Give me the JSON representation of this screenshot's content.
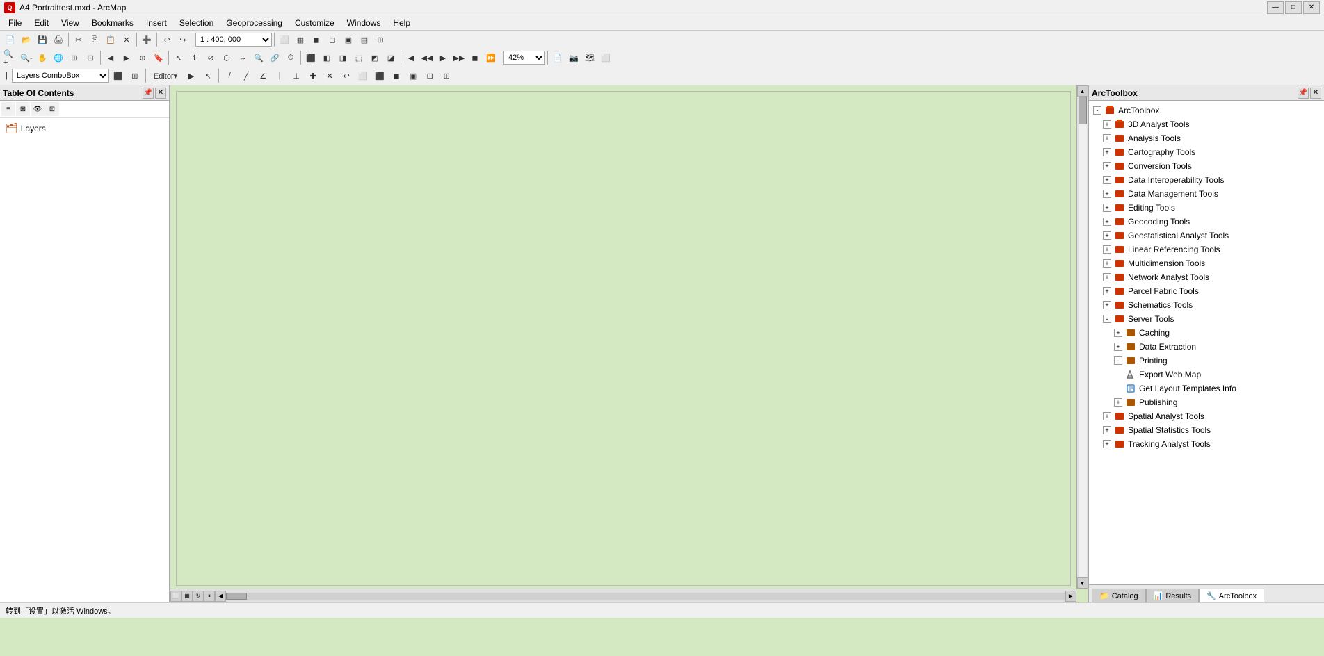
{
  "titleBar": {
    "title": "A4 Portraittest.mxd - ArcMap",
    "appIcon": "Q",
    "minBtn": "—",
    "maxBtn": "□",
    "closeBtn": "✕"
  },
  "menuBar": {
    "items": [
      "File",
      "Edit",
      "View",
      "Bookmarks",
      "Insert",
      "Selection",
      "Geoprocessing",
      "Customize",
      "Windows",
      "Help"
    ]
  },
  "toolbar": {
    "scale": "1 : 400, 000",
    "zoomPercent": "42%"
  },
  "editorToolbar": {
    "layersComboBox": "Layers ComboBox",
    "editorLabel": "Editor▾"
  },
  "toc": {
    "title": "Table Of Contents",
    "layers": [
      {
        "name": "Layers",
        "type": "group"
      }
    ]
  },
  "arctoolbox": {
    "title": "ArcToolbox",
    "root": "ArcToolbox",
    "items": [
      {
        "id": "3d-analyst",
        "label": "3D Analyst Tools",
        "level": 1,
        "expanded": false,
        "hasChildren": true
      },
      {
        "id": "analysis",
        "label": "Analysis Tools",
        "level": 1,
        "expanded": false,
        "hasChildren": true
      },
      {
        "id": "cartography",
        "label": "Cartography Tools",
        "level": 1,
        "expanded": false,
        "hasChildren": true
      },
      {
        "id": "conversion",
        "label": "Conversion Tools",
        "level": 1,
        "expanded": false,
        "hasChildren": true
      },
      {
        "id": "data-interop",
        "label": "Data Interoperability Tools",
        "level": 1,
        "expanded": false,
        "hasChildren": true
      },
      {
        "id": "data-mgmt",
        "label": "Data Management Tools",
        "level": 1,
        "expanded": false,
        "hasChildren": true
      },
      {
        "id": "editing",
        "label": "Editing Tools",
        "level": 1,
        "expanded": false,
        "hasChildren": true
      },
      {
        "id": "geocoding",
        "label": "Geocoding Tools",
        "level": 1,
        "expanded": false,
        "hasChildren": true
      },
      {
        "id": "geostatistical",
        "label": "Geostatistical Analyst Tools",
        "level": 1,
        "expanded": false,
        "hasChildren": true
      },
      {
        "id": "linear-ref",
        "label": "Linear Referencing Tools",
        "level": 1,
        "expanded": false,
        "hasChildren": true
      },
      {
        "id": "multidimension",
        "label": "Multidimension Tools",
        "level": 1,
        "expanded": false,
        "hasChildren": true
      },
      {
        "id": "network-analyst",
        "label": "Network Analyst Tools",
        "level": 1,
        "expanded": false,
        "hasChildren": true
      },
      {
        "id": "parcel-fabric",
        "label": "Parcel Fabric Tools",
        "level": 1,
        "expanded": false,
        "hasChildren": true
      },
      {
        "id": "schematics",
        "label": "Schematics Tools",
        "level": 1,
        "expanded": false,
        "hasChildren": true
      },
      {
        "id": "server",
        "label": "Server Tools",
        "level": 1,
        "expanded": true,
        "hasChildren": true
      },
      {
        "id": "caching",
        "label": "Caching",
        "level": 2,
        "expanded": false,
        "hasChildren": true
      },
      {
        "id": "data-extraction",
        "label": "Data Extraction",
        "level": 2,
        "expanded": false,
        "hasChildren": true
      },
      {
        "id": "printing",
        "label": "Printing",
        "level": 2,
        "expanded": true,
        "hasChildren": true
      },
      {
        "id": "export-web-map",
        "label": "Export Web Map",
        "level": 3,
        "expanded": false,
        "hasChildren": false
      },
      {
        "id": "get-layout-templates",
        "label": "Get Layout Templates Info",
        "level": 3,
        "expanded": false,
        "hasChildren": false
      },
      {
        "id": "publishing",
        "label": "Publishing",
        "level": 2,
        "expanded": false,
        "hasChildren": true
      },
      {
        "id": "spatial-analyst",
        "label": "Spatial Analyst Tools",
        "level": 1,
        "expanded": false,
        "hasChildren": true
      },
      {
        "id": "spatial-statistics",
        "label": "Spatial Statistics Tools",
        "level": 1,
        "expanded": false,
        "hasChildren": true
      },
      {
        "id": "tracking-analyst",
        "label": "Tracking Analyst Tools",
        "level": 1,
        "expanded": false,
        "hasChildren": true
      }
    ]
  },
  "bottomTabs": {
    "items": [
      {
        "id": "catalog",
        "label": "Catalog"
      },
      {
        "id": "results",
        "label": "Results",
        "active": false
      },
      {
        "id": "arctoolbox",
        "label": "ArcToolbox",
        "active": true
      }
    ]
  },
  "statusBar": {
    "text1": "转到「设置」以激活 Windows。"
  }
}
